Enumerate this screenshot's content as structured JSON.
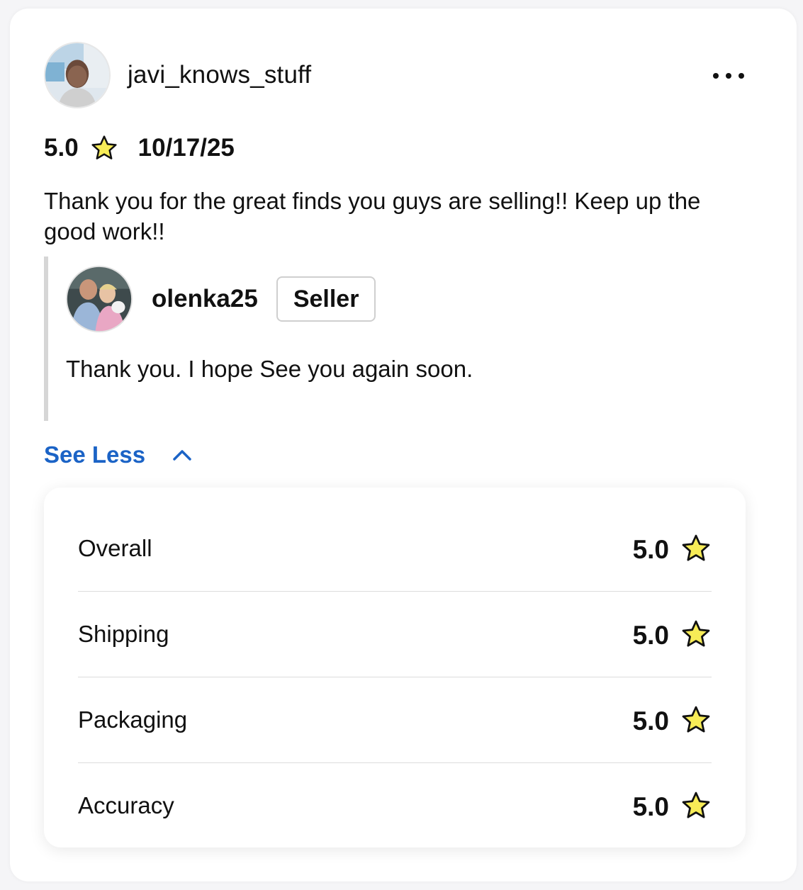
{
  "review": {
    "username": "javi_knows_stuff",
    "rating": "5.0",
    "date": "10/17/25",
    "text": "Thank you for the great finds you guys are selling!! Keep up the good work!!",
    "more_icon": "more-horizontal-icon"
  },
  "reply": {
    "username": "olenka25",
    "badge": "Seller",
    "text": "Thank you. I hope See you again soon."
  },
  "toggle": {
    "label": "See Less",
    "icon": "chevron-up-icon"
  },
  "breakdown": [
    {
      "label": "Overall",
      "score": "5.0"
    },
    {
      "label": "Shipping",
      "score": "5.0"
    },
    {
      "label": "Packaging",
      "score": "5.0"
    },
    {
      "label": "Accuracy",
      "score": "5.0"
    }
  ],
  "colors": {
    "link": "#1b63c6",
    "star_fill": "#f7ec57",
    "star_stroke": "#111111",
    "divider": "#dcdcdc"
  }
}
